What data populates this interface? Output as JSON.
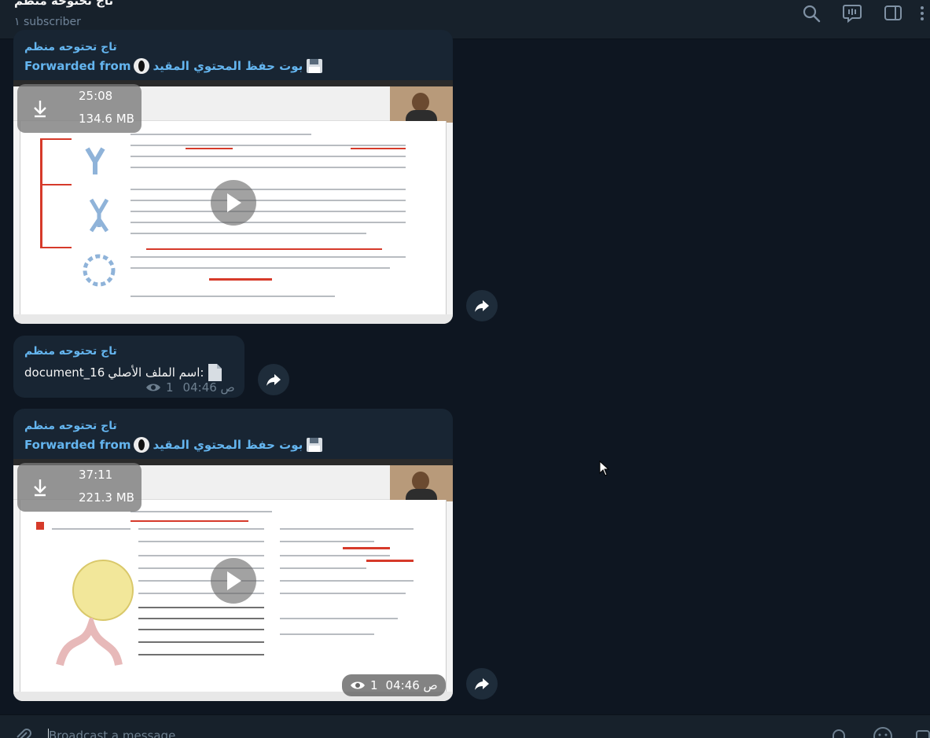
{
  "header": {
    "title": "تاج تحتوحه منظم",
    "subscribers": "١ subscriber",
    "icons": [
      "search-icon",
      "live-stream-icon",
      "sidebar-toggle-icon",
      "more-icon"
    ]
  },
  "messages": [
    {
      "type": "video",
      "sender": "تاج تحتوحه منظم",
      "forwarded_label": "Forwarded from",
      "forwarded_source": "بوت حفظ المحتوي المقيد",
      "duration": "25:08",
      "size": "134.6 MB"
    },
    {
      "type": "document",
      "sender": "تاج تحتوحه منظم",
      "text_label": "اسم الملف الأصلي:",
      "filename": "document_16",
      "time": "04:46 ص",
      "views": "1"
    },
    {
      "type": "video",
      "sender": "تاج تحتوحه منظم",
      "forwarded_label": "Forwarded from",
      "forwarded_source": "بوت حفظ المحتوي المقيد",
      "duration": "37:11",
      "size": "221.3 MB",
      "time": "04:46 ص",
      "views": "1"
    }
  ],
  "composer": {
    "placeholder": "Broadcast a message...",
    "icons": [
      "attach-icon",
      "notifications-icon",
      "emoji-icon",
      "send-icon"
    ]
  },
  "colors": {
    "background": "#0e1621",
    "panel": "#17212b",
    "bubble": "#182533",
    "accent": "#64b5ef",
    "muted": "#6d7f8f"
  }
}
